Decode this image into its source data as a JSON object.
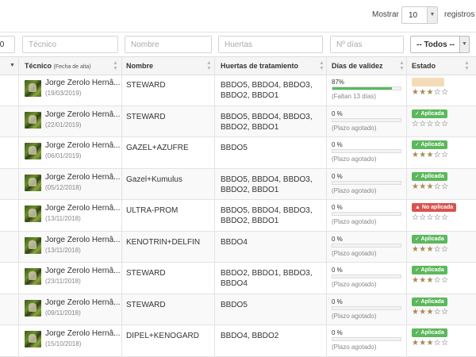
{
  "toolbar": {
    "mostrar_label": "Mostrar",
    "page_size": "10",
    "registros_label": "registros"
  },
  "filters": {
    "date_partial": "/0",
    "tecnico_placeholder": "Técnico",
    "nombre_placeholder": "Nombre",
    "huertas_placeholder": "Huertas",
    "dias_placeholder": "Nº días",
    "estado_value": "-- Todos --"
  },
  "columns": {
    "tecnico": "Técnico",
    "tecnico_sub": "(Fecha de alta)",
    "nombre": "Nombre",
    "huertas": "Huertas de tratamiento",
    "dias": "Días de validez",
    "estado": "Estado"
  },
  "icons": {
    "dropdown": "caret-down-icon",
    "sort": "sort-icon",
    "star": "star-icon",
    "avatar": "user-avatar"
  },
  "colors": {
    "applied": "#5cb85c",
    "not_applied": "#d9534f",
    "pending": "#f5dcb8",
    "progress": "#5cb85c",
    "star_on": "#a88b55"
  },
  "rows": [
    {
      "tecnico": "Jorge Zerolo Hernâ...",
      "fecha": "(19/03/2019)",
      "nombre": "STEWARD",
      "huertas": "BBDO5, BBDO4, BBDO3, BBDO2, BBDO1",
      "pct": "87%",
      "progress": 0.87,
      "plazo": "(Faltan 13 días)",
      "estado": "",
      "estado_type": "pending",
      "rating": 3
    },
    {
      "tecnico": "Jorge Zerolo Hernâ...",
      "fecha": "(22/01/2019)",
      "nombre": "STEWARD",
      "huertas": "BBDO5, BBDO4, BBDO3, BBDO2, BBDO1",
      "pct": "0 %",
      "progress": 0,
      "plazo": "(Plazo agotado)",
      "estado": "✓ Aplicada",
      "estado_type": "ok",
      "rating": 0
    },
    {
      "tecnico": "Jorge Zerolo Hernâ...",
      "fecha": "(06/01/2019)",
      "nombre": "GAZEL+AZUFRE",
      "huertas": "BBDO5",
      "pct": "0 %",
      "progress": 0,
      "plazo": "(Plazo agotado)",
      "estado": "✓ Aplicada",
      "estado_type": "ok",
      "rating": 3
    },
    {
      "tecnico": "Jorge Zerolo Hernâ...",
      "fecha": "(05/12/2018)",
      "nombre": "Gazel+Kumulus",
      "huertas": "BBDO5, BBDO4, BBDO3, BBDO2, BBDO1",
      "pct": "0 %",
      "progress": 0,
      "plazo": "(Plazo agotado)",
      "estado": "✓ Aplicada",
      "estado_type": "ok",
      "rating": 3
    },
    {
      "tecnico": "Jorge Zerolo Hernâ...",
      "fecha": "(13/11/2018)",
      "nombre": "ULTRA-PROM",
      "huertas": "BBDO5, BBDO4, BBDO3, BBDO2, BBDO1",
      "pct": "0 %",
      "progress": 0,
      "plazo": "(Plazo agotado)",
      "estado": "▲ No aplicada",
      "estado_type": "bad",
      "rating": 0
    },
    {
      "tecnico": "Jorge Zerolo Hernâ...",
      "fecha": "(13/11/2018)",
      "nombre": "KENOTRIN+DELFIN",
      "huertas": "BBDO4",
      "pct": "0 %",
      "progress": 0,
      "plazo": "(Plazo agotado)",
      "estado": "✓ Aplicada",
      "estado_type": "ok",
      "rating": 3
    },
    {
      "tecnico": "Jorge Zerolo Hernâ...",
      "fecha": "(23/11/2018)",
      "nombre": "STEWARD",
      "huertas": "BBDO2, BBDO1, BBDO3, BBDO4",
      "pct": "0 %",
      "progress": 0,
      "plazo": "(Plazo agotado)",
      "estado": "✓ Aplicada",
      "estado_type": "ok",
      "rating": 3
    },
    {
      "tecnico": "Jorge Zerolo Hernâ...",
      "fecha": "(09/11/2018)",
      "nombre": "STEWARD",
      "huertas": "BBDO5",
      "pct": "0 %",
      "progress": 0,
      "plazo": "(Plazo agotado)",
      "estado": "✓ Aplicada",
      "estado_type": "ok",
      "rating": 3
    },
    {
      "tecnico": "Jorge Zerolo Hernâ...",
      "fecha": "(15/10/2018)",
      "nombre": "DIPEL+KENOGARD",
      "huertas": "BBDO4, BBDO2",
      "pct": "0 %",
      "progress": 0,
      "plazo": "(Plazo agotado)",
      "estado": "✓ Aplicada",
      "estado_type": "ok",
      "rating": 3
    }
  ]
}
